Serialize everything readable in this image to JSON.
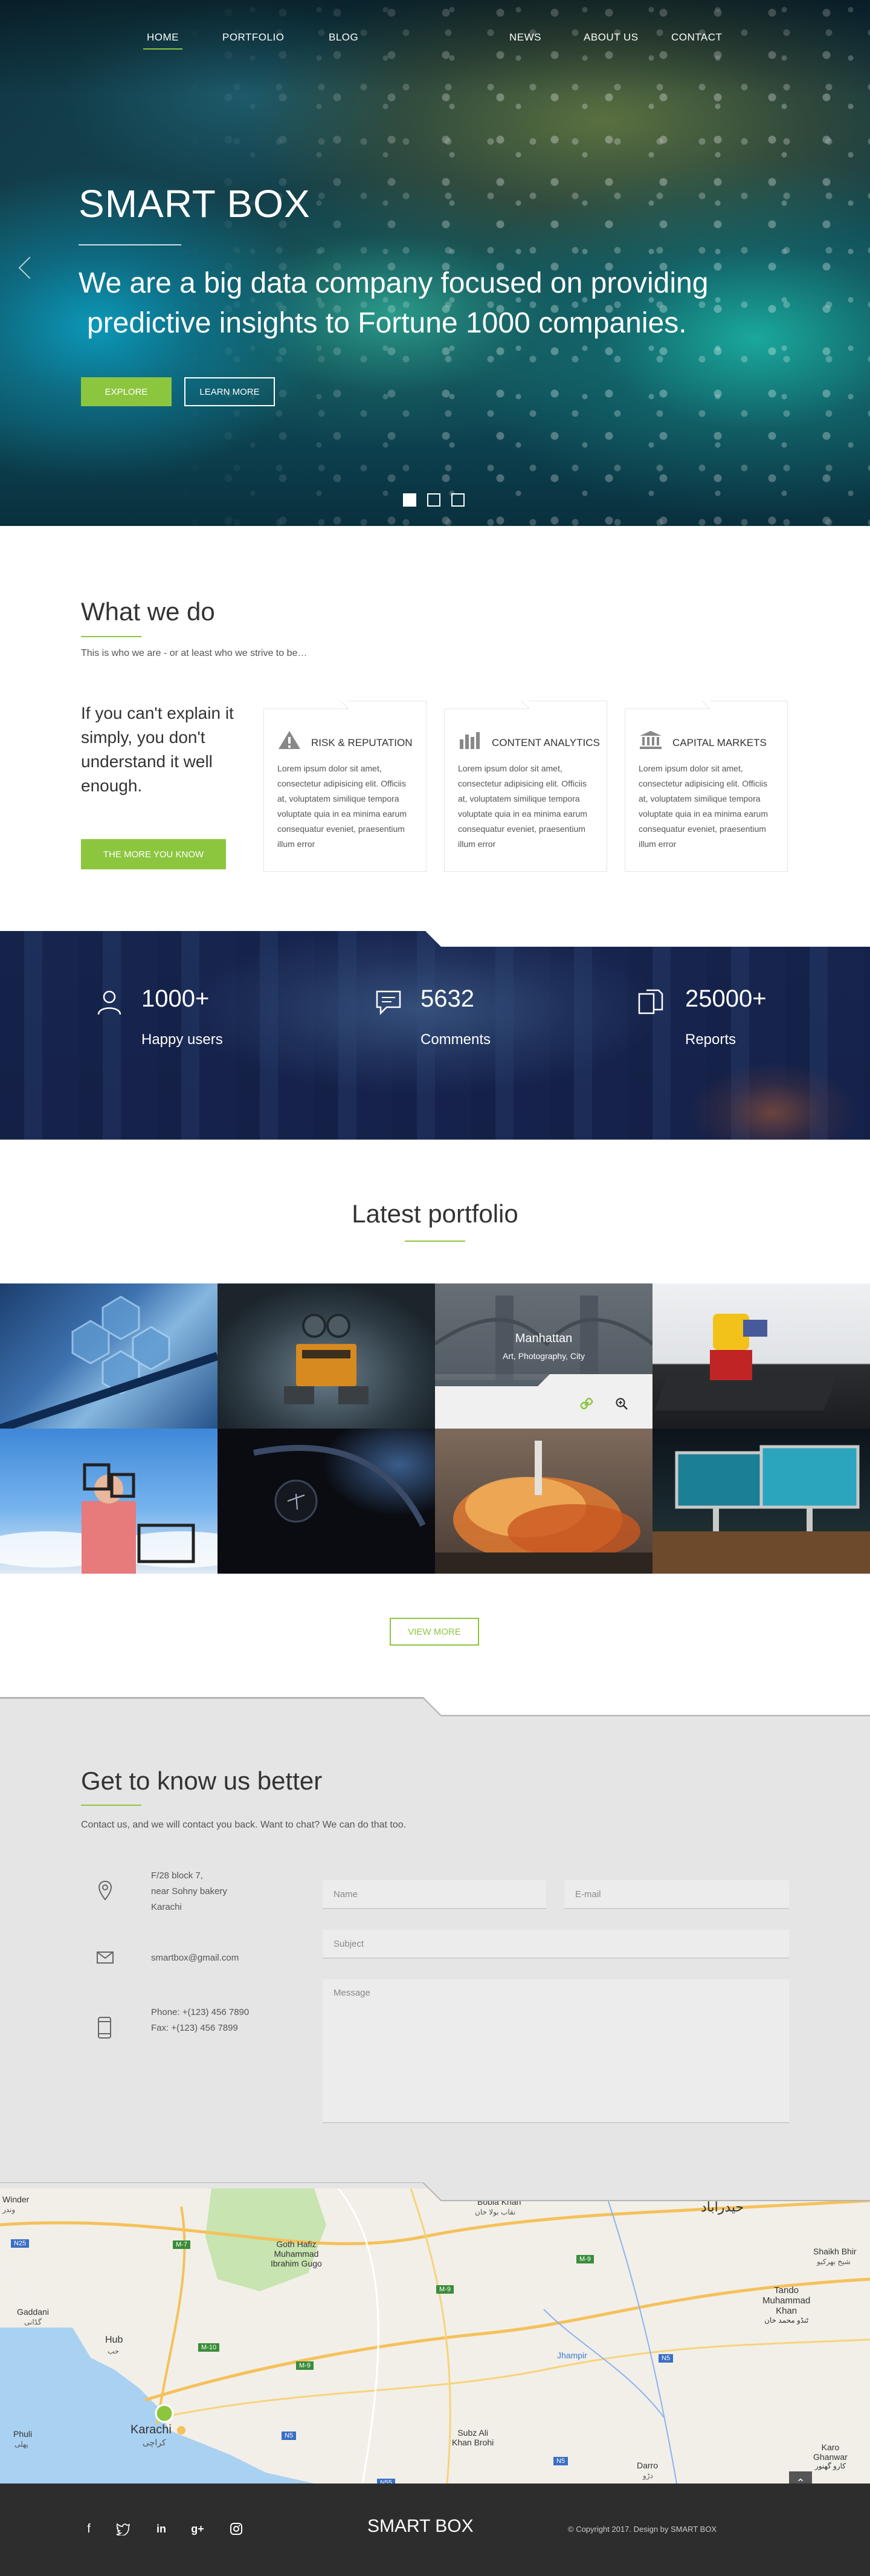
{
  "nav": {
    "left": [
      "HOME",
      "PORTFOLIO",
      "BLOG"
    ],
    "right": [
      "NEWS",
      "ABOUT US",
      "CONTACT"
    ],
    "active": "HOME"
  },
  "hero": {
    "title": "SMART BOX",
    "subtitle_line1": "We are a big data company focused on providing",
    "subtitle_line2": "predictive insights to Fortune 1000 companies.",
    "explore_label": "EXPLORE",
    "learn_label": "LEARN MORE"
  },
  "what": {
    "heading": "What we do",
    "tagline": "This is who we are - or at least who we strive to be…",
    "quote": "If you can't explain it simply, you don't understand it well enough.",
    "cta": "THE MORE YOU KNOW",
    "cards": [
      {
        "icon": "warning-icon",
        "title": "RISK & REPUTATION",
        "text": "Lorem ipsum dolor sit amet, consectetur adipisicing elit. Officiis at, voluptatem similique tempora voluptate quia in ea minima earum consequatur eveniet, praesentium illum error"
      },
      {
        "icon": "bar-chart-icon",
        "title": "CONTENT ANALYTICS",
        "text": "Lorem ipsum dolor sit amet, consectetur adipisicing elit. Officiis at, voluptatem similique tempora voluptate quia in ea minima earum consequatur eveniet, praesentium illum error"
      },
      {
        "icon": "bank-icon",
        "title": "CAPITAL MARKETS",
        "text": "Lorem ipsum dolor sit amet, consectetur adipisicing elit. Officiis at, voluptatem similique tempora voluptate quia in ea minima earum consequatur eveniet, praesentium illum error"
      }
    ]
  },
  "stats": [
    {
      "icon": "user-icon",
      "value": "1000+",
      "label": "Happy users"
    },
    {
      "icon": "comment-icon",
      "value": "5632",
      "label": "Comments"
    },
    {
      "icon": "documents-icon",
      "value": "25000+",
      "label": "Reports"
    }
  ],
  "portfolio": {
    "heading": "Latest portfolio",
    "hover_title": "Manhattan",
    "hover_tags": "Art, Photography, City",
    "view_more": "VIEW MORE"
  },
  "contact": {
    "heading": "Get to know us better",
    "tagline": "Contact us, and we will contact you back. Want to chat? We can do that too.",
    "address_line1": "F/28 block 7,",
    "address_line2": "near Sohny bakery",
    "address_line3": "Karachi",
    "email": "smartbox@gmail.com",
    "phone": "Phone: +(123) 456 7890",
    "fax": "Fax: +(123) 456 7899",
    "name_placeholder": "Name",
    "email_placeholder": "E-mail",
    "subject_placeholder": "Subject",
    "message_placeholder": "Message"
  },
  "map": {
    "labels": {
      "winder": "Winder",
      "winder_ur": "وندر",
      "goth": "Goth Hafiz",
      "muhammad": "Muhammad",
      "ibrahim": "Ibrahim Gugo",
      "bobla": "Bobla Khan",
      "bobla_ur": "نقاب بولا خان",
      "hyderabad": "حیدرآباد",
      "shaikh": "Shaikh Bhir",
      "shaikh_ur": "شیخ بھرکیو",
      "gaddani": "Gaddani",
      "gaddani_ur": "گڈانی",
      "hub": "Hub",
      "hub_ur": "حب",
      "tando": "Tando",
      "tando2": "Muhammad",
      "tando3": "Khan",
      "tando_ur": "ٹنڈو محمد خان",
      "jhampir": "Jhampir",
      "phuli": "Phuli",
      "phuli_ur": "پھلی",
      "karachi": "Karachi",
      "karachi_ur": "کراچی",
      "subz": "Subz Ali",
      "subz2": "Khan Brohi",
      "darro": "Darro",
      "darro_ur": "دڑو",
      "karo": "Karo",
      "karo2": "Ghanwar",
      "karo_ur": "کارو گھنور"
    },
    "roads": [
      "N25",
      "M-7",
      "M-9",
      "M-10",
      "M-9",
      "N5",
      "N5",
      "N5",
      "N55",
      "M-9"
    ]
  },
  "footer": {
    "brand": "SMART BOX",
    "copyright": "© Copyright 2017. Design by SMART BOX",
    "social": [
      "facebook-icon",
      "twitter-icon",
      "linkedin-icon",
      "google-plus-icon",
      "instagram-icon"
    ]
  },
  "colors": {
    "accent": "#8cc63f",
    "footer": "#2d2d2d",
    "contact_bg": "#e5e5e5"
  }
}
